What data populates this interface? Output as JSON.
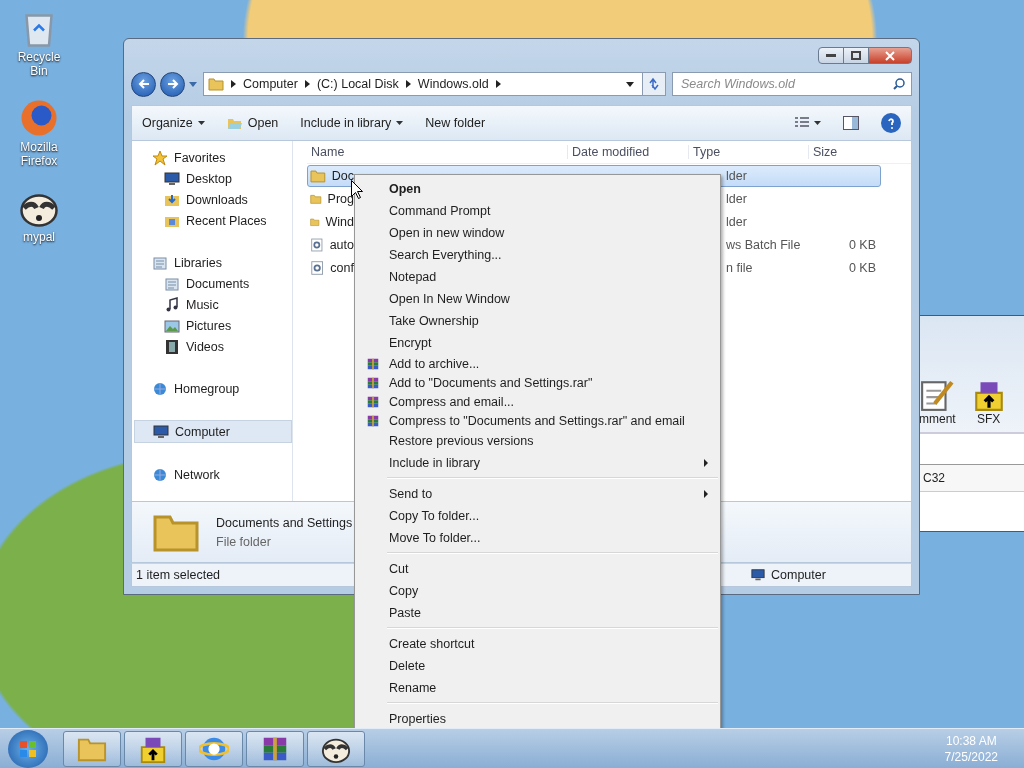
{
  "desktop_icons": [
    {
      "label": "Recycle Bin",
      "kind": "bin"
    },
    {
      "label": "Mozilla Firefox",
      "kind": "firefox"
    },
    {
      "label": "mypal",
      "kind": "raccoon"
    }
  ],
  "background_window": {
    "toolbar": [
      {
        "label": "mment",
        "kind": "comment"
      },
      {
        "label": "SFX",
        "kind": "sfx"
      }
    ],
    "column": "C32"
  },
  "explorer": {
    "breadcrumbs": [
      "Computer",
      "(C:) Local Disk",
      "Windows.old"
    ],
    "search": {
      "placeholder": "Search Windows.old"
    },
    "toolbar": [
      {
        "label": "Organize",
        "kind": "plain",
        "dropdown": true
      },
      {
        "label": "Open",
        "kind": "open",
        "dropdown": false
      },
      {
        "label": "Include in library",
        "kind": "plain",
        "dropdown": true
      },
      {
        "label": "New folder",
        "kind": "plain",
        "dropdown": false
      }
    ],
    "nav": [
      {
        "label": "Favorites",
        "kind": "star",
        "selected": false,
        "children": [
          {
            "label": "Desktop",
            "kind": "desktop",
            "selected": false
          },
          {
            "label": "Downloads",
            "kind": "downloads",
            "selected": false
          },
          {
            "label": "Recent Places",
            "kind": "recent",
            "selected": false
          }
        ]
      },
      {
        "label": "Libraries",
        "kind": "library",
        "selected": false,
        "children": [
          {
            "label": "Documents",
            "kind": "documents",
            "selected": false
          },
          {
            "label": "Music",
            "kind": "music",
            "selected": false
          },
          {
            "label": "Pictures",
            "kind": "pictures",
            "selected": false
          },
          {
            "label": "Videos",
            "kind": "videos",
            "selected": false
          }
        ]
      },
      {
        "label": "Homegroup",
        "kind": "homegroup",
        "selected": false
      },
      {
        "label": "Computer",
        "kind": "computer",
        "selected": true
      },
      {
        "label": "Network",
        "kind": "network",
        "selected": false
      }
    ],
    "columns": [
      "Name",
      "Date modified",
      "Type",
      "Size"
    ],
    "rows": [
      {
        "name": "Doc",
        "kind": "folder",
        "type": "lder",
        "size": "",
        "selected": true
      },
      {
        "name": "Prog",
        "kind": "folder",
        "type": "lder",
        "size": "",
        "selected": false
      },
      {
        "name": "Wind",
        "kind": "folder",
        "type": "lder",
        "size": "",
        "selected": false
      },
      {
        "name": "auto",
        "kind": "batch",
        "type": "ws Batch File",
        "size": "0 KB",
        "selected": false
      },
      {
        "name": "conf",
        "kind": "config",
        "type": "n file",
        "size": "0 KB",
        "selected": false
      }
    ],
    "details": {
      "name": "Documents and Settings",
      "type": "File folder"
    },
    "status_bar": {
      "selection": "1 item selected",
      "zone": "Computer"
    }
  },
  "context_menu": [
    {
      "kind": "item",
      "label": "Open",
      "bold": true,
      "archive": false,
      "submenu": false
    },
    {
      "kind": "item",
      "label": "Command Prompt",
      "bold": false,
      "archive": false,
      "submenu": false
    },
    {
      "kind": "item",
      "label": "Open in new window",
      "bold": false,
      "archive": false,
      "submenu": false
    },
    {
      "kind": "item",
      "label": "Search Everything...",
      "bold": false,
      "archive": false,
      "submenu": false
    },
    {
      "kind": "item",
      "label": "Notepad",
      "bold": false,
      "archive": false,
      "submenu": false
    },
    {
      "kind": "item",
      "label": "Open In New Window",
      "bold": false,
      "archive": false,
      "submenu": false
    },
    {
      "kind": "item",
      "label": "Take Ownership",
      "bold": false,
      "archive": false,
      "submenu": false
    },
    {
      "kind": "item",
      "label": "Encrypt",
      "bold": false,
      "archive": false,
      "submenu": false
    },
    {
      "kind": "item",
      "label": "Add to archive...",
      "bold": false,
      "archive": true,
      "submenu": false
    },
    {
      "kind": "item",
      "label": "Add to \"Documents and Settings.rar\"",
      "bold": false,
      "archive": true,
      "submenu": false
    },
    {
      "kind": "item",
      "label": "Compress and email...",
      "bold": false,
      "archive": true,
      "submenu": false
    },
    {
      "kind": "item",
      "label": "Compress to \"Documents and Settings.rar\" and email",
      "bold": false,
      "archive": true,
      "submenu": false
    },
    {
      "kind": "item",
      "label": "Restore previous versions",
      "bold": false,
      "archive": false,
      "submenu": false
    },
    {
      "kind": "item",
      "label": "Include in library",
      "bold": false,
      "archive": false,
      "submenu": true
    },
    {
      "kind": "separator"
    },
    {
      "kind": "item",
      "label": "Send to",
      "bold": false,
      "archive": false,
      "submenu": true
    },
    {
      "kind": "item",
      "label": "Copy To folder...",
      "bold": false,
      "archive": false,
      "submenu": false
    },
    {
      "kind": "item",
      "label": "Move To folder...",
      "bold": false,
      "archive": false,
      "submenu": false
    },
    {
      "kind": "separator"
    },
    {
      "kind": "item",
      "label": "Cut",
      "bold": false,
      "archive": false,
      "submenu": false
    },
    {
      "kind": "item",
      "label": "Copy",
      "bold": false,
      "archive": false,
      "submenu": false
    },
    {
      "kind": "item",
      "label": "Paste",
      "bold": false,
      "archive": false,
      "submenu": false
    },
    {
      "kind": "separator"
    },
    {
      "kind": "item",
      "label": "Create shortcut",
      "bold": false,
      "archive": false,
      "submenu": false
    },
    {
      "kind": "item",
      "label": "Delete",
      "bold": false,
      "archive": false,
      "submenu": false
    },
    {
      "kind": "item",
      "label": "Rename",
      "bold": false,
      "archive": false,
      "submenu": false
    },
    {
      "kind": "separator"
    },
    {
      "kind": "item",
      "label": "Properties",
      "bold": false,
      "archive": false,
      "submenu": false
    }
  ],
  "taskbar": {
    "buttons": [
      {
        "kind": "explorer"
      },
      {
        "kind": "sfx"
      },
      {
        "kind": "browser"
      },
      {
        "kind": "archiver"
      },
      {
        "kind": "raccoon"
      }
    ],
    "time": "10:38 AM",
    "date": "7/25/2022"
  }
}
